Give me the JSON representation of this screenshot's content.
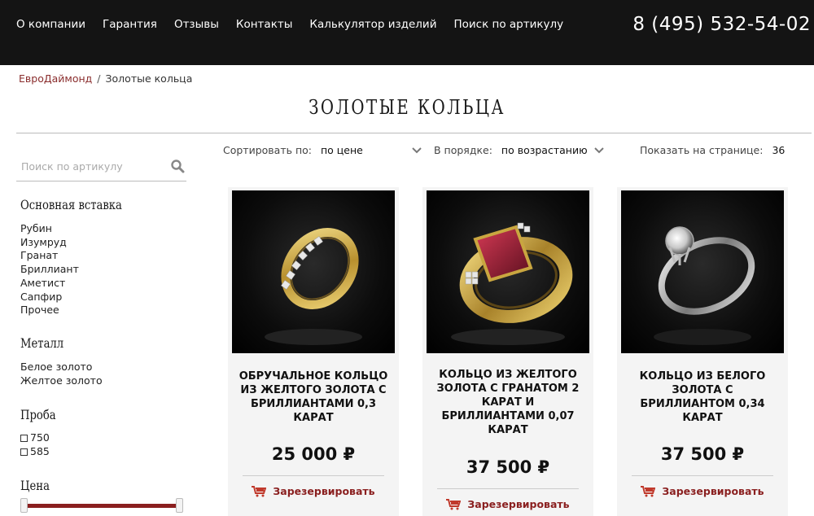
{
  "header": {
    "nav": [
      "О компании",
      "Гарантия",
      "Отзывы",
      "Контакты",
      "Калькулятор изделий",
      "Поиск по артикулу"
    ],
    "phone": "8 (495) 532-54-02"
  },
  "breadcrumb": {
    "home": "ЕвроДаймонд",
    "separator": "/",
    "current": "Золотые кольца"
  },
  "page_title": "Золотые кольца",
  "sidebar": {
    "search_placeholder": "Поиск по артикулу",
    "insert": {
      "title": "Основная вставка",
      "items": [
        "Рубин",
        "Изумруд",
        "Гранат",
        "Бриллиант",
        "Аметист",
        "Сапфир",
        "Прочее"
      ]
    },
    "metal": {
      "title": "Металл",
      "items": [
        "Белое золото",
        "Желтое золото"
      ]
    },
    "probe": {
      "title": "Проба",
      "items": [
        "750",
        "585"
      ]
    },
    "price": {
      "title": "Цена"
    }
  },
  "sort": {
    "sort_label": "Сортировать по:",
    "sort_value": "по цене",
    "order_label": "В порядке:",
    "order_value": "по возрастанию",
    "perpage_label": "Показать на странице:",
    "perpage_value": "36"
  },
  "products": [
    {
      "name": "Обручальное кольцо из желтого золота с бриллиантами 0,3 карат",
      "price": "25 000 ₽",
      "action": "Зарезервировать"
    },
    {
      "name": "Кольцо из желтого золота с гранатом 2 карат и бриллиантами 0,07 карат",
      "price": "37 500 ₽",
      "action": "Зарезервировать"
    },
    {
      "name": "Кольцо из белого золота с бриллиантом 0,34 карат",
      "price": "37 500 ₽",
      "action": "Зарезервировать"
    }
  ],
  "colors": {
    "accent": "#8a1f1f",
    "header_bg": "#141414",
    "card_bg": "#f4f4f4"
  }
}
